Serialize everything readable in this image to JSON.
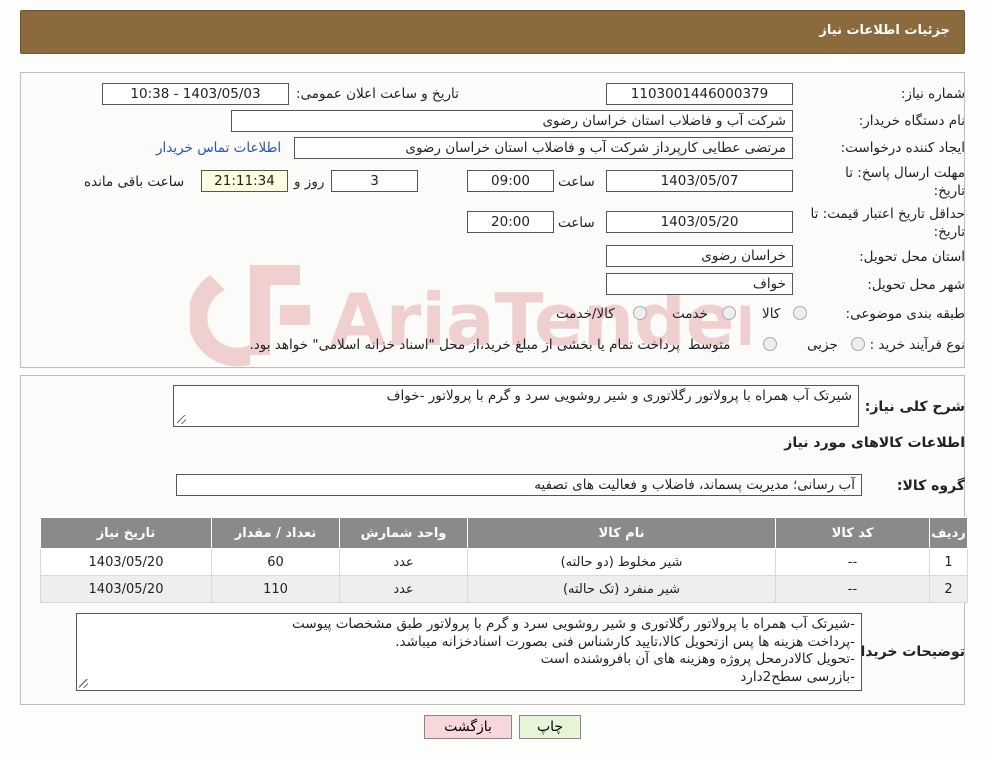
{
  "header": {
    "title": "جزئیات اطلاعات نیاز"
  },
  "form": {
    "need_number_label": "شماره نیاز:",
    "need_number": "1103001446000379",
    "announce_label": "تاریخ و ساعت اعلان عمومی:",
    "announce_value": "1403/05/03 - 10:38",
    "buyer_org_label": "نام دستگاه خریدار:",
    "buyer_org": "شرکت آب و فاضلاب استان خراسان رضوی",
    "creator_label": "ایجاد کننده درخواست:",
    "creator": "مرتضی عطایی کارپرداز شرکت آب و فاضلاب استان خراسان رضوی",
    "contact_link": "اطلاعات تماس خریدار",
    "deadline_label_1": "مهلت ارسال پاسخ: تا",
    "deadline_label_2": "تاریخ:",
    "deadline_date": "1403/05/07",
    "time_label": "ساعت",
    "deadline_time": "09:00",
    "days_value": "3",
    "days_label": "روز و",
    "remaining_time": "21:11:34",
    "remaining_label": "ساعت باقی مانده",
    "validity_label_1": "حداقل تاریخ اعتبار قیمت: تا",
    "validity_label_2": "تاریخ:",
    "validity_date": "1403/05/20",
    "validity_time": "20:00",
    "province_label": "استان محل تحویل:",
    "province": "خراسان رضوی",
    "city_label": "شهر محل تحویل:",
    "city": "خواف",
    "category_label": "طبقه بندی موضوعی:",
    "category_options": [
      "کالا",
      "خدمت",
      "کالا/خدمت"
    ],
    "process_label": "نوع فرآیند خرید :",
    "process_options": [
      "جزیی",
      "متوسط"
    ],
    "payment_note": "پرداخت تمام یا بخشی از مبلغ خرید،از محل \"اسناد خزانه اسلامی\" خواهد بود."
  },
  "summary": {
    "label": "شرح کلی نیاز:",
    "value": "شیرتک آب همراه با پرولاتور رگلاتوری و شیر روشویی سرد و گرم با پرولاتور -خواف",
    "goods_info_title": "اطلاعات کالاهای مورد نیاز",
    "group_label": "گروه کالا:",
    "group_value": "آب رسانی؛ مدیریت پسماند، فاضلاب و فعالیت های تصفیه"
  },
  "table": {
    "headers": [
      "ردیف",
      "کد کالا",
      "نام کالا",
      "واحد شمارش",
      "تعداد / مقدار",
      "تاریخ نیاز"
    ],
    "rows": [
      [
        "1",
        "--",
        "شیر مخلوط (دو حالته)",
        "عدد",
        "60",
        "1403/05/20"
      ],
      [
        "2",
        "--",
        "شیر منفرد (تک حالته)",
        "عدد",
        "110",
        "1403/05/20"
      ]
    ]
  },
  "buyer_notes": {
    "label": "توضیحات خریدار:",
    "lines": [
      "-شیرتک آب همراه با پرولاتور رگلاتوری و شیر روشویی سرد و گرم با پرولاتور طبق مشخصات پیوست",
      "-پرداخت هزینه ها پس ازتحویل کالا،تایید کارشناس فنی بصورت اسنادخزانه میباشد.",
      "-تحویل کالادرمحل پروژه وهزینه های آن بافروشنده است",
      "-بازرسی سطح2دارد"
    ]
  },
  "buttons": {
    "print": "چاپ",
    "back": "بازگشت"
  },
  "watermark": {
    "text": "AriaTender.neT"
  },
  "colors": {
    "header_bg": "#8b6b3d",
    "link": "#2a52be",
    "back_btn": "#f8d7da",
    "print_btn": "#e6f4d7"
  }
}
